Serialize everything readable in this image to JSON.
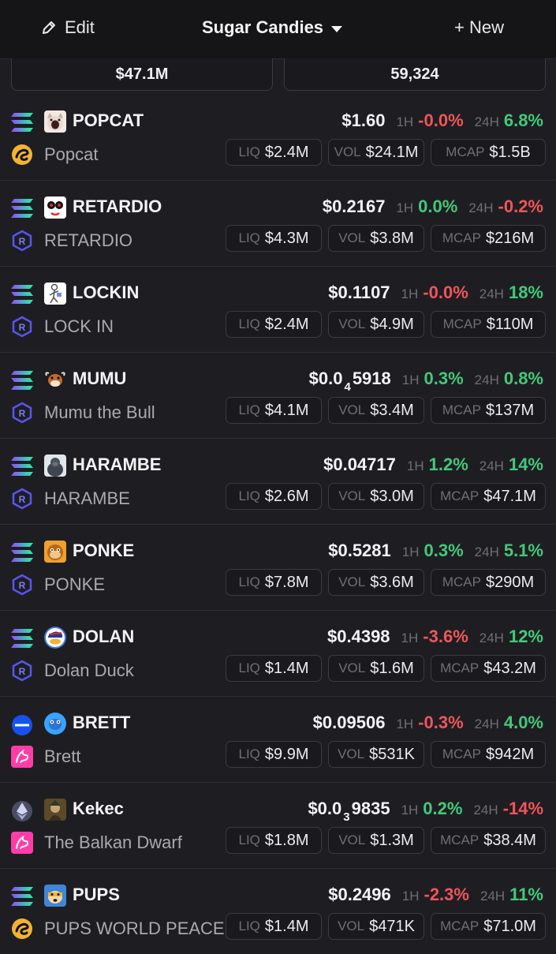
{
  "header": {
    "edit_label": "Edit",
    "watchlist_name": "Sugar Candies",
    "new_label": "+ New"
  },
  "stats": {
    "left_value": "$47.1M",
    "right_value": "59,324"
  },
  "labels": {
    "h1": "1H",
    "h24": "24H",
    "liq": "LIQ",
    "vol": "VOL",
    "mcap": "MCAP"
  },
  "tokens": [
    {
      "symbol": "POPCAT",
      "name": "Popcat",
      "chain": "solana",
      "dex": "sushi",
      "price": "$1.60",
      "ch1h": "-0.0%",
      "ch1h_dir": "neg",
      "ch24h": "6.8%",
      "ch24h_dir": "pos",
      "liq": "$2.4M",
      "vol": "$24.1M",
      "mcap": "$1.5B",
      "icon": "cat-icon"
    },
    {
      "symbol": "RETARDIO",
      "name": "RETARDIO",
      "chain": "solana",
      "dex": "raydium",
      "price": "$0.2167",
      "ch1h": "0.0%",
      "ch1h_dir": "pos",
      "ch24h": "-0.2%",
      "ch24h_dir": "neg",
      "liq": "$4.3M",
      "vol": "$3.8M",
      "mcap": "$216M",
      "icon": "face-icon"
    },
    {
      "symbol": "LOCKIN",
      "name": "LOCK IN",
      "chain": "solana",
      "dex": "raydium",
      "price": "$0.1107",
      "ch1h": "-0.0%",
      "ch1h_dir": "neg",
      "ch24h": "18%",
      "ch24h_dir": "pos",
      "liq": "$2.4M",
      "vol": "$4.9M",
      "mcap": "$110M",
      "icon": "figure-icon"
    },
    {
      "symbol": "MUMU",
      "name": "Mumu the Bull",
      "chain": "solana",
      "dex": "raydium",
      "price_main": "$0.0",
      "price_sub": "4",
      "price_tail": "5918",
      "ch1h": "0.3%",
      "ch1h_dir": "pos",
      "ch24h": "0.8%",
      "ch24h_dir": "pos",
      "liq": "$4.1M",
      "vol": "$3.4M",
      "mcap": "$137M",
      "icon": "bull-icon"
    },
    {
      "symbol": "HARAMBE",
      "name": "HARAMBE",
      "chain": "solana",
      "dex": "raydium",
      "price": "$0.04717",
      "ch1h": "1.2%",
      "ch1h_dir": "pos",
      "ch24h": "14%",
      "ch24h_dir": "pos",
      "liq": "$2.6M",
      "vol": "$3.0M",
      "mcap": "$47.1M",
      "icon": "gorilla-icon"
    },
    {
      "symbol": "PONKE",
      "name": "PONKE",
      "chain": "solana",
      "dex": "raydium",
      "price": "$0.5281",
      "ch1h": "0.3%",
      "ch1h_dir": "pos",
      "ch24h": "5.1%",
      "ch24h_dir": "pos",
      "liq": "$7.8M",
      "vol": "$3.6M",
      "mcap": "$290M",
      "icon": "monkey-icon"
    },
    {
      "symbol": "DOLAN",
      "name": "Dolan Duck",
      "chain": "solana",
      "dex": "raydium",
      "price": "$0.4398",
      "ch1h": "-3.6%",
      "ch1h_dir": "neg",
      "ch24h": "12%",
      "ch24h_dir": "pos",
      "liq": "$1.4M",
      "vol": "$1.6M",
      "mcap": "$43.2M",
      "icon": "duck-icon"
    },
    {
      "symbol": "BRETT",
      "name": "Brett",
      "chain": "base",
      "dex": "uniswap",
      "price": "$0.09506",
      "ch1h": "-0.3%",
      "ch1h_dir": "neg",
      "ch24h": "4.0%",
      "ch24h_dir": "pos",
      "liq": "$9.9M",
      "vol": "$531K",
      "mcap": "$942M",
      "icon": "brett-icon"
    },
    {
      "symbol": "Kekec",
      "name": "The Balkan Dwarf",
      "chain": "ethereum",
      "dex": "uniswap",
      "price_main": "$0.0",
      "price_sub": "3",
      "price_tail": "9835",
      "ch1h": "0.2%",
      "ch1h_dir": "pos",
      "ch24h": "-14%",
      "ch24h_dir": "neg",
      "liq": "$1.8M",
      "vol": "$1.3M",
      "mcap": "$38.4M",
      "icon": "dwarf-icon"
    },
    {
      "symbol": "PUPS",
      "name": "PUPS WORLD PEACE",
      "chain": "solana",
      "dex": "sushi",
      "price": "$0.2496",
      "ch1h": "-2.3%",
      "ch1h_dir": "neg",
      "ch24h": "11%",
      "ch24h_dir": "pos",
      "liq": "$1.4M",
      "vol": "$471K",
      "mcap": "$71.0M",
      "icon": "dog-icon"
    }
  ],
  "colors": {
    "positive": "#43c97a",
    "negative": "#f0555a",
    "background": "#1e1e22"
  }
}
